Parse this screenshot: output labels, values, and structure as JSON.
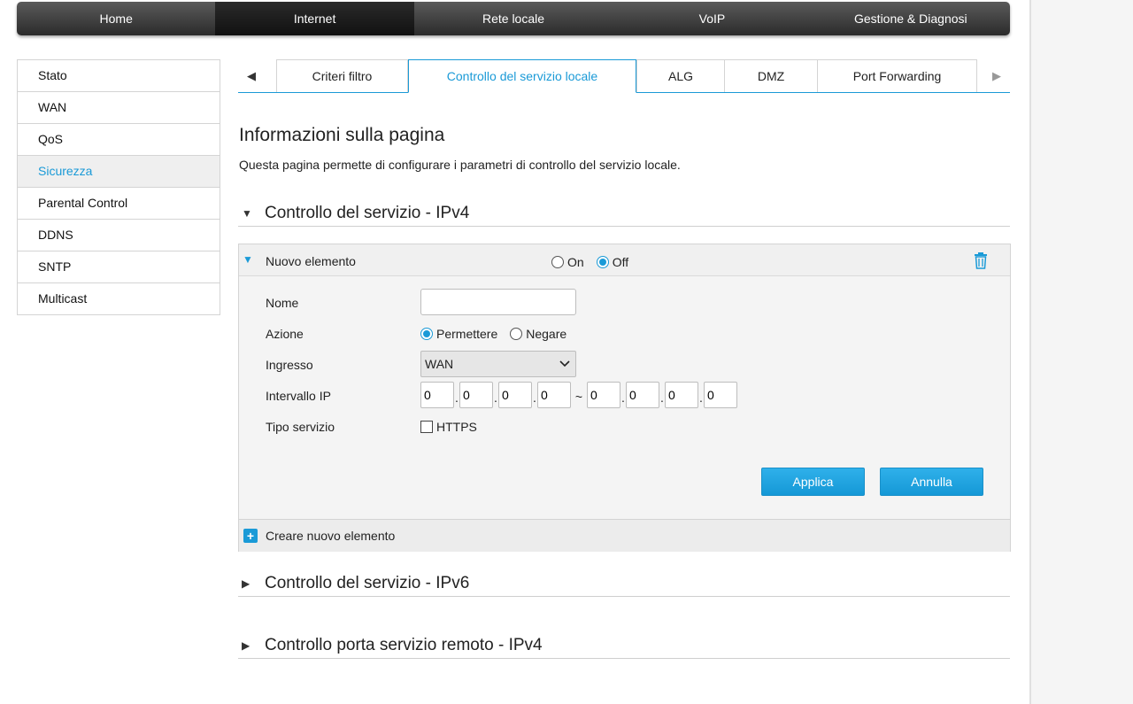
{
  "topnav": {
    "items": [
      "Home",
      "Internet",
      "Rete locale",
      "VoIP",
      "Gestione & Diagnosi"
    ],
    "active_index": 1
  },
  "sidebar": {
    "items": [
      "Stato",
      "WAN",
      "QoS",
      "Sicurezza",
      "Parental Control",
      "DDNS",
      "SNTP",
      "Multicast"
    ],
    "active_index": 3
  },
  "tabs": {
    "items": [
      "Criteri filtro",
      "Controllo del servizio locale",
      "ALG",
      "DMZ",
      "Port Forwarding"
    ],
    "active_index": 1,
    "left_arrow": "◀",
    "right_arrow": "▶"
  },
  "page": {
    "title": "Informazioni sulla pagina",
    "description": "Questa pagina permette di configurare i parametri di controllo del servizio locale."
  },
  "sections": {
    "ipv4": "Controllo del servizio - IPv4",
    "ipv6": "Controllo del servizio - IPv6",
    "remote": "Controllo porta servizio remoto - IPv4"
  },
  "entry": {
    "title": "Nuovo elemento",
    "on_label": "On",
    "off_label": "Off",
    "state": "Off",
    "fields": {
      "name_label": "Nome",
      "name_value": "",
      "action_label": "Azione",
      "allow_label": "Permettere",
      "deny_label": "Negare",
      "action_value": "Permettere",
      "ingress_label": "Ingresso",
      "ingress_value": "WAN",
      "ip_range_label": "Intervallo IP",
      "ip_start": [
        "0",
        "0",
        "0",
        "0"
      ],
      "ip_end": [
        "0",
        "0",
        "0",
        "0"
      ],
      "ip_separator": ".",
      "ip_range_separator": "~",
      "service_type_label": "Tipo servizio",
      "service_https_label": "HTTPS",
      "service_https_checked": false
    },
    "apply_label": "Applica",
    "cancel_label": "Annulla",
    "create_label": "Creare nuovo elemento"
  },
  "colors": {
    "accent": "#1a9ad7",
    "nav_dark": "#2b2b2b"
  }
}
